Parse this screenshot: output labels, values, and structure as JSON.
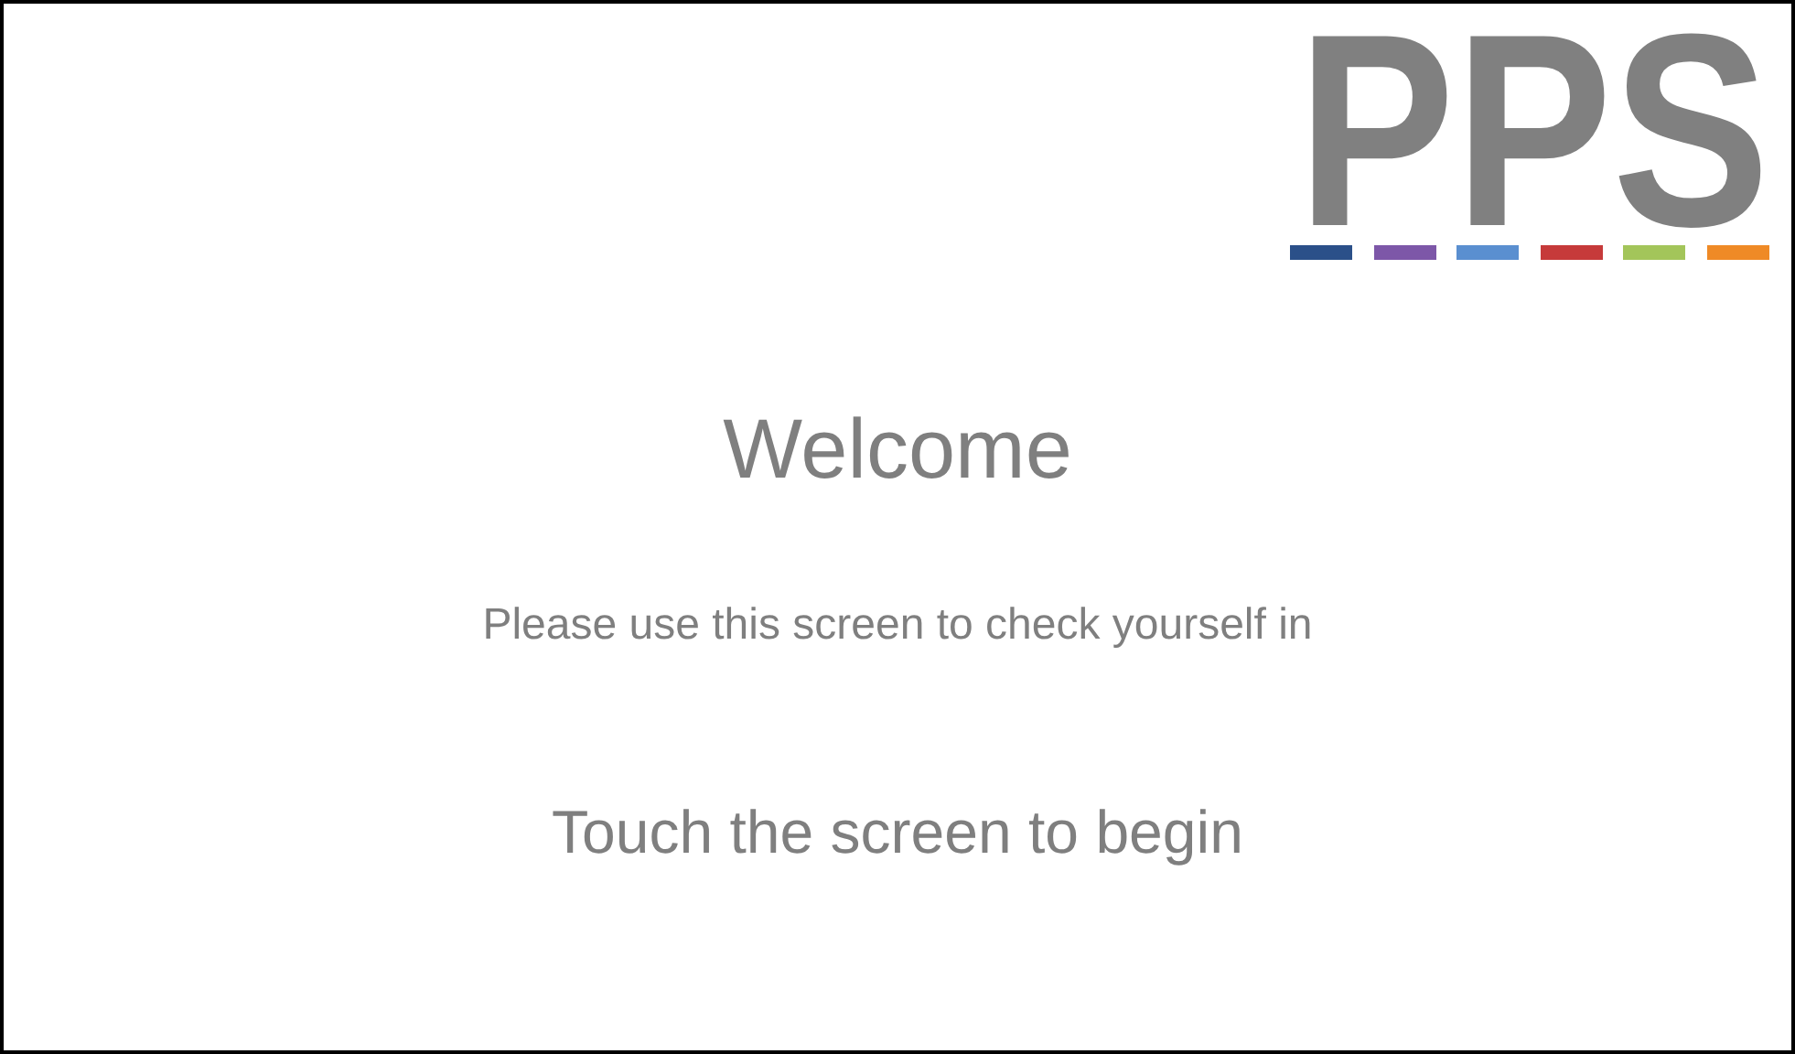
{
  "logo": {
    "text": "PPS",
    "stripes": [
      {
        "color": "#2b5089"
      },
      {
        "color": "#7d57a8"
      },
      {
        "color": "#5a8fd0"
      },
      {
        "color": "#c63a3a"
      },
      {
        "color": "#a3c55a"
      },
      {
        "color": "#ef8a26"
      }
    ]
  },
  "title": "Welcome",
  "subtitle": "Please use this screen to check yourself in",
  "prompt": "Touch the screen to begin"
}
